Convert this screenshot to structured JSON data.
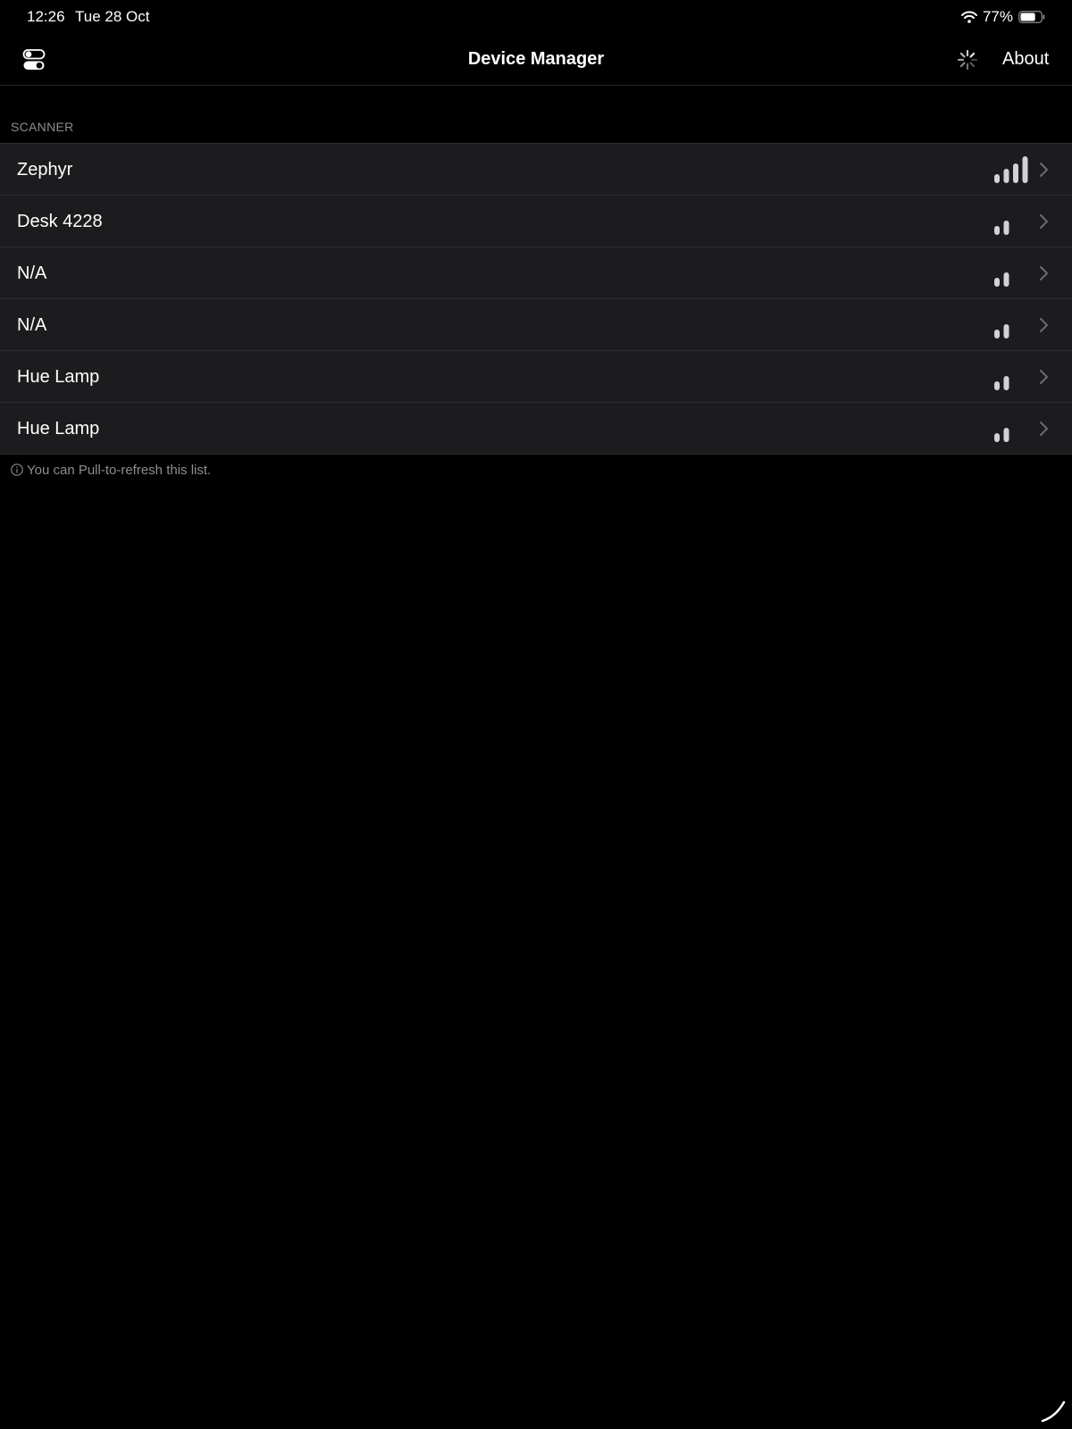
{
  "status_bar": {
    "time": "12:26",
    "date": "Tue 28 Oct",
    "battery_percent": "77%",
    "battery_level": 0.77,
    "icons": [
      "wifi-icon",
      "battery-icon"
    ]
  },
  "nav": {
    "title": "Device Manager",
    "left_button_icon": "toggles-icon",
    "loading_icon": "activity-spinner-icon",
    "about_label": "About"
  },
  "scanner": {
    "header": "SCANNER",
    "devices": [
      {
        "name": "Zephyr",
        "signal_bars": 4
      },
      {
        "name": "Desk 4228",
        "signal_bars": 2
      },
      {
        "name": "N/A",
        "signal_bars": 2
      },
      {
        "name": "N/A",
        "signal_bars": 2
      },
      {
        "name": "Hue Lamp",
        "signal_bars": 2
      },
      {
        "name": "Hue Lamp",
        "signal_bars": 2
      }
    ],
    "footer": "You can Pull-to-refresh this list.",
    "footer_icon": "info-icon"
  },
  "colors": {
    "background": "#000000",
    "row_background": "#1c1c1e",
    "secondary_text": "#8d8d93",
    "signal_active": "#d1d1d6",
    "signal_inactive": "#48484a"
  }
}
